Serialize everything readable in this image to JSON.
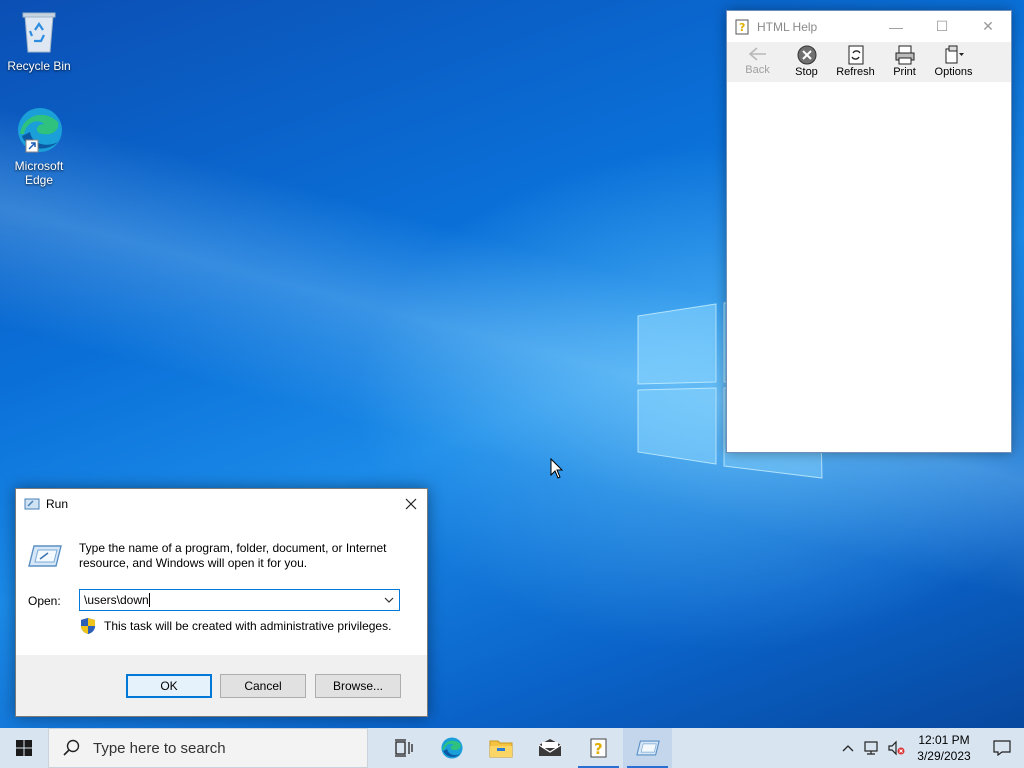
{
  "desktop": {
    "icons": [
      {
        "label": "Recycle Bin",
        "icon": "recycle-bin-icon"
      },
      {
        "label": "Microsoft Edge",
        "icon": "edge-icon"
      }
    ]
  },
  "html_help": {
    "title": "HTML Help",
    "toolbar": [
      {
        "label": "Back",
        "icon": "back-arrow-icon",
        "enabled": false
      },
      {
        "label": "Stop",
        "icon": "stop-icon",
        "enabled": true
      },
      {
        "label": "Refresh",
        "icon": "refresh-icon",
        "enabled": true
      },
      {
        "label": "Print",
        "icon": "printer-icon",
        "enabled": true
      },
      {
        "label": "Options",
        "icon": "options-icon",
        "enabled": true
      }
    ]
  },
  "run_dialog": {
    "title": "Run",
    "description": "Type the name of a program, folder, document, or Internet resource, and Windows will open it for you.",
    "open_label": "Open:",
    "open_value": "\\users\\down",
    "admin_notice": "This task will be created with administrative privileges.",
    "buttons": {
      "ok": "OK",
      "cancel": "Cancel",
      "browse": "Browse..."
    }
  },
  "taskbar": {
    "search_placeholder": "Type here to search",
    "apps": [
      "task-view-icon",
      "edge-icon",
      "file-explorer-icon",
      "mail-icon",
      "html-help-icon",
      "run-icon"
    ],
    "clock": {
      "time": "12:01 PM",
      "date": "3/29/2023"
    }
  },
  "colors": {
    "accent": "#0078d7",
    "taskbar": "#d9e4f1",
    "desktop": "#0a63c9"
  }
}
